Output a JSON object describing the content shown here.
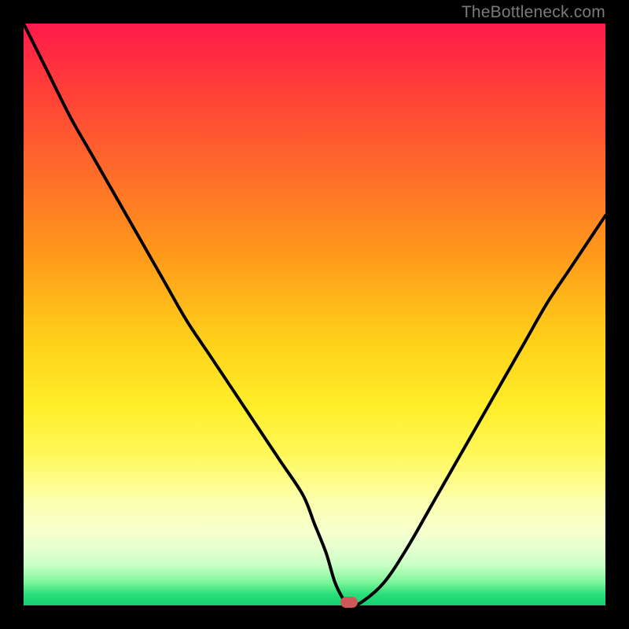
{
  "watermark": "TheBottleneck.com",
  "colors": {
    "frame": "#000000",
    "grad_top": "#ff1a4a",
    "grad_bottom": "#16cf74",
    "curve": "#000000",
    "marker": "#cf5757"
  },
  "chart_data": {
    "type": "line",
    "title": "",
    "xlabel": "",
    "ylabel": "",
    "xlim": [
      0,
      100
    ],
    "ylim": [
      0,
      100
    ],
    "grid": false,
    "legend": false,
    "series": [
      {
        "name": "bottleneck-curve",
        "x": [
          0,
          4,
          8,
          12,
          16,
          20,
          24,
          28,
          32,
          36,
          40,
          44,
          48,
          50,
          52,
          53.5,
          55,
          56,
          58,
          62,
          66,
          70,
          74,
          78,
          82,
          86,
          90,
          94,
          98,
          100
        ],
        "values": [
          100,
          92,
          84,
          77,
          70,
          63,
          56,
          49,
          43,
          37,
          31,
          25,
          19,
          14,
          9,
          4,
          1,
          0,
          0.5,
          4,
          10,
          17,
          24,
          31,
          38,
          45,
          52,
          58,
          64,
          67
        ]
      }
    ],
    "marker": {
      "x": 56,
      "y": 0.5
    }
  }
}
